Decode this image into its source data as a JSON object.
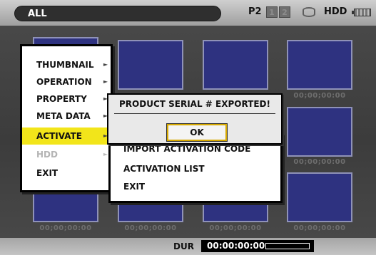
{
  "status_bar": {
    "mode": "ALL",
    "p2_label": "P2",
    "slot_1": "1",
    "slot_2": "2",
    "hdd_label": "HDD",
    "icons": [
      "drive-icon",
      "battery-icon"
    ]
  },
  "thumbnails": {
    "timecodes": [
      "00;00;00:00",
      "00;00;00:00",
      "00;00;00:00",
      "00;00;00:00",
      "00;00;00:00",
      "00;00;00:00"
    ]
  },
  "menu": {
    "items": [
      {
        "label": "THUMBNAIL",
        "submenu": true,
        "state": "normal"
      },
      {
        "label": "OPERATION",
        "submenu": true,
        "state": "normal"
      },
      {
        "label": "PROPERTY",
        "submenu": true,
        "state": "normal"
      },
      {
        "label": "META DATA",
        "submenu": true,
        "state": "normal"
      },
      {
        "label": "ACTIVATE",
        "submenu": true,
        "state": "selected"
      },
      {
        "label": "HDD",
        "submenu": true,
        "state": "disabled"
      },
      {
        "label": "EXIT",
        "submenu": false,
        "state": "normal"
      }
    ],
    "arrow_glyph": "►"
  },
  "submenu": {
    "items": [
      "IMPORT ACTIVATION CODE",
      "ACTIVATION LIST",
      "EXIT"
    ]
  },
  "dialog": {
    "message": "PRODUCT SERIAL # EXPORTED!",
    "ok_label": "OK"
  },
  "bottom_bar": {
    "dur_label": "DUR",
    "dur_value": "00:00:00:00"
  },
  "colors": {
    "highlight": "#f2e51a",
    "thumbnail_fill": "#2e3280",
    "ok_border": "#d6a800"
  }
}
